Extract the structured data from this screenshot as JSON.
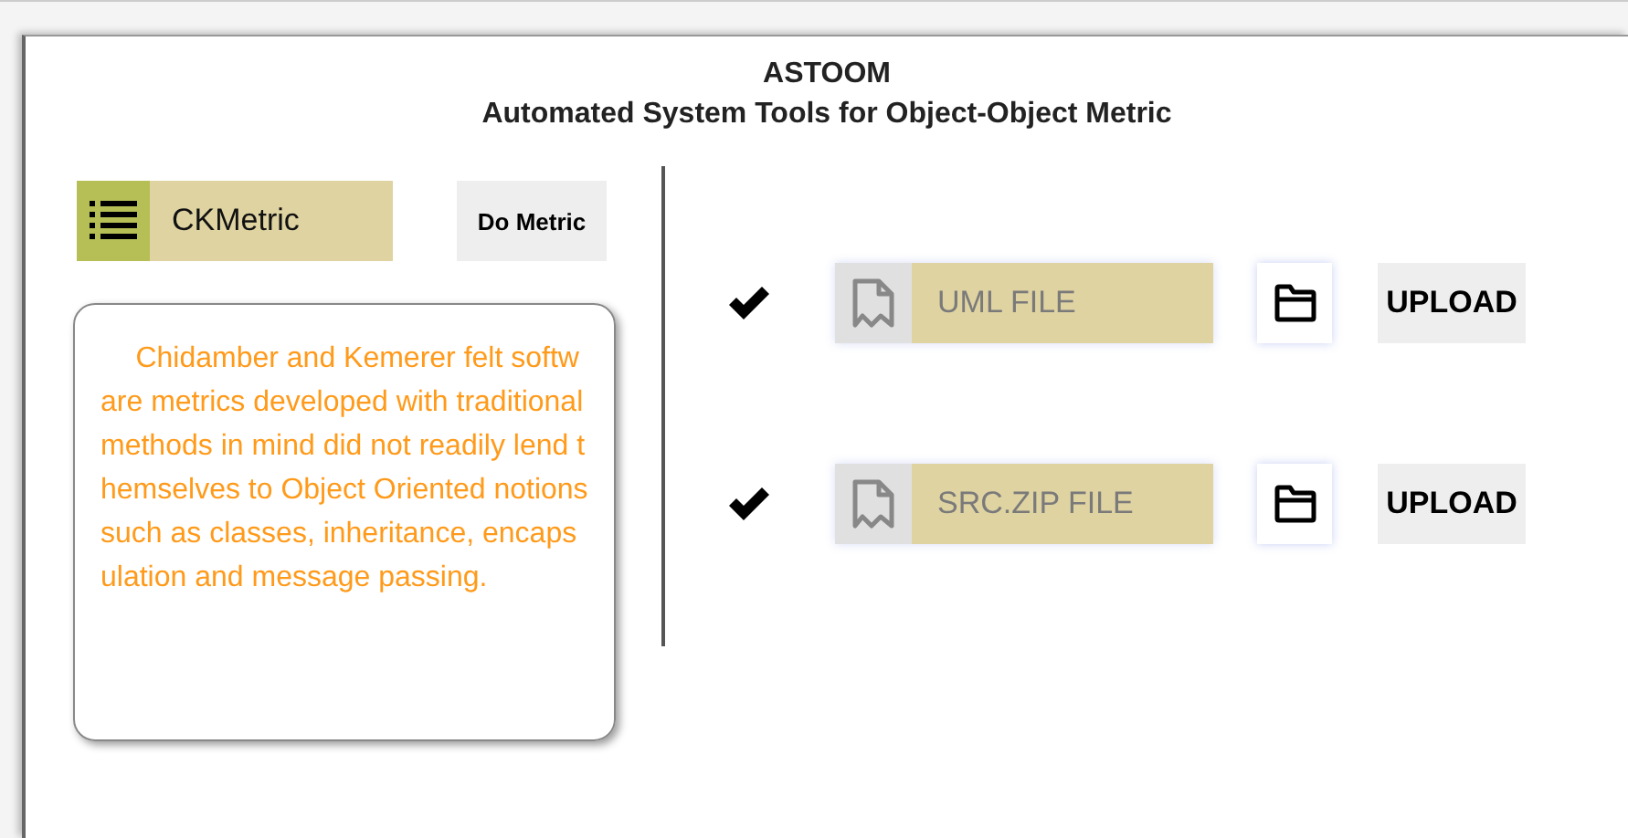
{
  "header": {
    "title": "ASTOOM",
    "subtitle": "Automated System Tools for Object-Object Metric"
  },
  "metric_select": {
    "value": "CKMetric"
  },
  "do_metric_button": "Do Metric",
  "description": "Chidamber and Kemerer felt software metrics developed with traditional methods in mind did not readily lend themselves to Object Oriented notions such as classes, inheritance, encapsulation and message passing.",
  "uploads": [
    {
      "checked": true,
      "placeholder": "UML FILE",
      "button": "UPLOAD"
    },
    {
      "checked": true,
      "placeholder": "SRC.ZIP FILE",
      "button": "UPLOAD"
    }
  ]
}
